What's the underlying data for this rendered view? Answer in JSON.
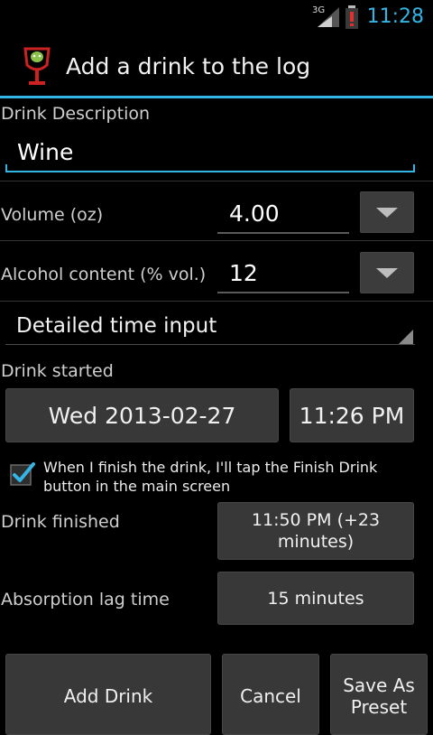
{
  "status_bar": {
    "network": "3G",
    "time": "11:28"
  },
  "header": {
    "title": "Add a drink to the log"
  },
  "form": {
    "description_label": "Drink Description",
    "description_value": "Wine",
    "volume_label": "Volume (oz)",
    "volume_value": "4.00",
    "alcohol_label": "Alcohol content (% vol.)",
    "alcohol_value": "12",
    "time_mode": "Detailed time input",
    "drink_started_label": "Drink started",
    "start_date": "Wed 2013-02-27",
    "start_time": "11:26 PM",
    "finish_checkbox_label": "When I finish the drink, I'll tap the Finish Drink button in the main screen",
    "finish_checked": true,
    "drink_finished_label": "Drink finished",
    "finish_time": "11:50 PM (+23 minutes)",
    "absorption_label": "Absorption lag time",
    "absorption_value": "15 minutes"
  },
  "actions": {
    "add": "Add Drink",
    "cancel": "Cancel",
    "save_preset": "Save As Preset"
  },
  "colors": {
    "accent": "#33b5e5",
    "background": "#000000",
    "button": "#383838"
  }
}
